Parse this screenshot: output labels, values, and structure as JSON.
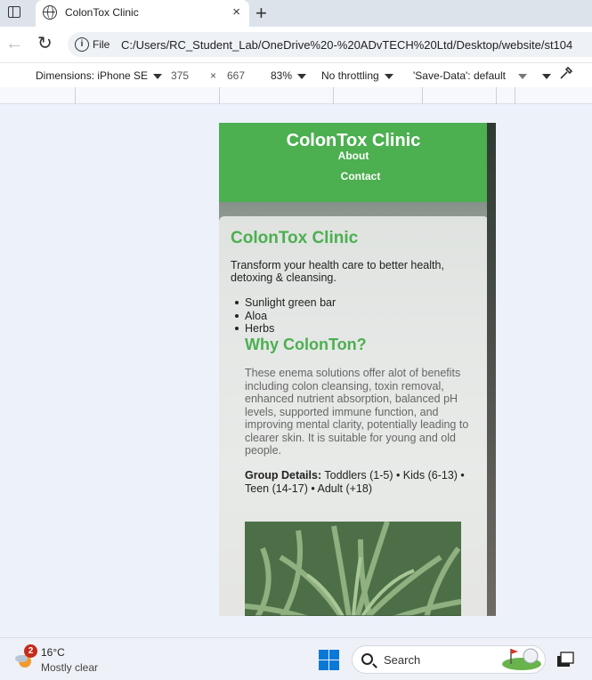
{
  "browser": {
    "tab_title": "ColonTox Clinic",
    "new_tab_symbol": "+",
    "close_symbol": "×",
    "address_scheme": "File",
    "url": "C:/Users/RC_Student_Lab/OneDrive%20-%20ADvTECH%20Ltd/Desktop/website/st104"
  },
  "device_toolbar": {
    "dimensions_label": "Dimensions: iPhone SE",
    "width": "375",
    "times": "×",
    "height": "667",
    "zoom": "83%",
    "throttling": "No throttling",
    "save_data": "'Save-Data': default"
  },
  "site": {
    "header_title": "ColonTox Clinic",
    "nav": {
      "about": "About",
      "contact": "Contact"
    },
    "heading": "ColonTox Clinic",
    "intro": "Transform your health care to better health, detoxing & cleansing.",
    "list_items": [
      "Sunlight green bar",
      "Aloa",
      "Herbs"
    ],
    "subheading": "Why ColonTon?",
    "description": "These enema solutions offer alot of benefits including colon cleansing, toxin removal, enhanced nutrient absorption, balanced pH levels, supported immune function, and improving mental clarity, potentially leading to clearer skin. It is suitable for young and old people.",
    "group_label": "Group Details:",
    "group_text": "Toddlers (1-5) • Kids (6-13) • Teen (14-17) • Adult (+18)",
    "accent_color": "#4caf50"
  },
  "taskbar": {
    "notification_count": "2",
    "temperature": "16°C",
    "condition": "Mostly clear",
    "search_label": "Search"
  }
}
